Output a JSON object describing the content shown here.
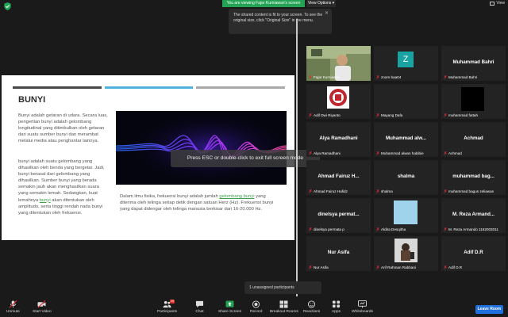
{
  "top": {
    "viewing_banner": "You are viewing Fajar Kurniawan's screen",
    "view_options": "View Options",
    "view_label": "View"
  },
  "tooltip": {
    "text": "The shared content is fit to your screen. To see the original size, click \"Original Size\" in the menu."
  },
  "slide": {
    "title": "BUNYI",
    "bar_colors": [
      "#474747",
      "#4fb3dd",
      "#a9a9a9"
    ],
    "para1": "Bunyi adalah getaran di udara. Secara luas, pengertian bunyi adalah gelombang longitudinal yang ditimbulkan oleh getaran dari suatu sumber bunyi dan merambat melalui media atau penghantar lainnya.",
    "para2_a": "bunyi adalah suatu gelombang yang dihasilkan oleh benda yang bergetar. Jadi, bunyi berasal dari gelombang yang dihasilkan. Sumber bunyi yang berada semakin jauh akan menghasilkan suara yang semakin lemah. Sedangkan, kuat lemahnya ",
    "para2_link": "bunyi",
    "para2_b": " akan ditentukan oleh amplitudo, serta tinggi rendah nada bunyi yang ditentukan oleh frekuensi.",
    "caption_a": "Dalam ilmu fisika, frekuensi bunyi adalah jumlah ",
    "caption_link": "gelombang bunyi",
    "caption_b": " yang diterima oleh telinga setiap detik dengan satuan Herz (Hz). Frekuensi bunyi yang dapat didengar oleh telinga manusia berkisar dari 16-20.000 Hz."
  },
  "esc_message": "Press ESC or double-click to exit full screen mode",
  "participants": [
    {
      "label": "Fajar Kurniawan",
      "big": "",
      "kind": "video"
    },
    {
      "label": "zoom baa04",
      "big": "",
      "kind": "avatar",
      "avatar_letter": "Z",
      "avatar_color": "#1aa3a3"
    },
    {
      "label": "Muhammad Bahri",
      "big": "Muhammad Bahri",
      "kind": "name"
    },
    {
      "label": "Adif Dwi Riyanto",
      "big": "",
      "kind": "logo"
    },
    {
      "label": "Mayang Dafa",
      "big": "",
      "kind": "blank"
    },
    {
      "label": "muhammad fattah",
      "big": "",
      "kind": "black"
    },
    {
      "label": "Alya Ramadhani",
      "big": "Alya Ramadhani",
      "kind": "name"
    },
    {
      "label": "Muhammad alwan habibie",
      "big": "Muhammad alw...",
      "kind": "name"
    },
    {
      "label": "Achmad",
      "big": "Achmad",
      "kind": "name"
    },
    {
      "label": "Ahmad Fairuz Hafidz",
      "big": "Ahmad Fairuz H...",
      "kind": "name"
    },
    {
      "label": "shalma",
      "big": "shalma",
      "kind": "name"
    },
    {
      "label": "muhammad bagus zeliawan",
      "big": "muhammad bag...",
      "kind": "name"
    },
    {
      "label": "dinelsya permata p",
      "big": "dinelsya permat...",
      "kind": "name"
    },
    {
      "label": "Aldira Desqitha",
      "big": "",
      "kind": "lightblue"
    },
    {
      "label": "M. Reza Armando 1162003011",
      "big": "M. Reza Armand...",
      "kind": "name"
    },
    {
      "label": "Nur Asifa",
      "big": "Nur Asifa",
      "kind": "name"
    },
    {
      "label": "Arif Rahman Rabbani",
      "big": "",
      "kind": "photo"
    },
    {
      "label": "Adif D.R",
      "big": "Adif D.R",
      "kind": "name"
    }
  ],
  "unassigned": "1 unassigned participants",
  "toolbar": {
    "unmute": "Unmute",
    "start_video": "Start Video",
    "participants": "Participants",
    "participants_count": "25",
    "chat": "Chat",
    "share_screen": "Share Screen",
    "record": "Record",
    "breakout": "Breakout Rooms",
    "reactions": "Reactions",
    "apps": "Apps",
    "whiteboards": "Whiteboards",
    "leave": "Leave Room"
  },
  "colors": {
    "share_green": "#23a455",
    "leave_blue": "#1f6fdc",
    "active_speaker": "#2dd36f"
  }
}
